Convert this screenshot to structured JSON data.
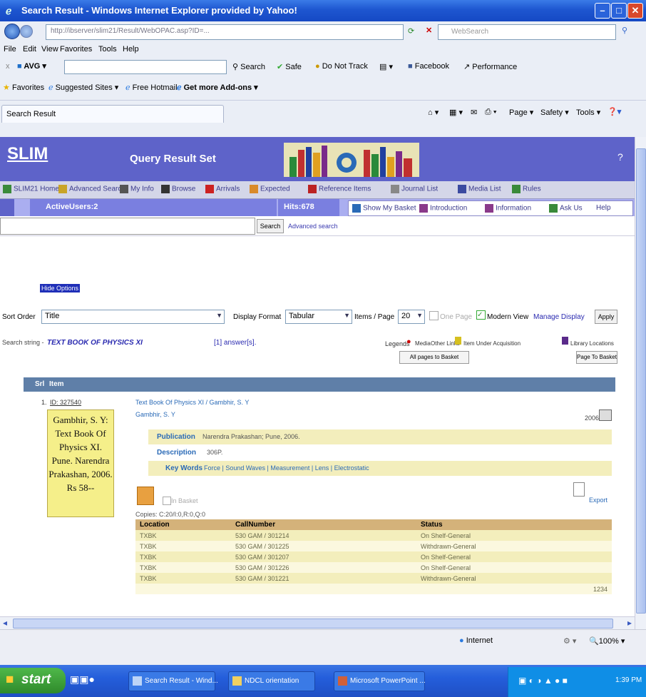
{
  "window": {
    "title": "Search Result - Windows Internet Explorer provided by Yahoo!"
  },
  "browser": {
    "address_url": "http://ibserver/slim21/Result/WebOPAC.asp?ID=...",
    "search_placeholder": "WebSearch",
    "menu": [
      "File",
      "Edit",
      "View",
      "Favorites",
      "Tools",
      "Help"
    ],
    "avg_label": "AVG",
    "toolbar": {
      "search": "Search",
      "safe": "Safe",
      "dnt": "Do Not Track",
      "facebook": "Facebook",
      "performance": "Performance"
    },
    "favorites": {
      "label": "Favorites",
      "suggested": "Suggested Sites",
      "hotmail": "Free Hotmail",
      "addons": "Get more Add-ons"
    },
    "tab_title": "Search Result",
    "command_bar": {
      "page": "Page",
      "safety": "Safety",
      "tools": "Tools"
    }
  },
  "slim": {
    "logo": "SLIM",
    "heading": "Query Result Set",
    "menu": [
      "SLIM21 Home",
      "Advanced Search",
      "My Info",
      "Browse",
      "Arrivals",
      "Expected",
      "Reference Items",
      "Journal List",
      "Media List",
      "Rules"
    ],
    "active_users": "ActiveUsers:2",
    "hits": "Hits:678",
    "links": [
      "Show My Basket",
      "Introduction",
      "Information",
      "Ask Us",
      "Help"
    ],
    "search_button": "Search",
    "advanced_search": "Advanced search",
    "hide_options": "Hide Options",
    "sort_label": "Sort Order",
    "sort_value": "Title",
    "display_format_label": "Display Format",
    "display_format_value": "Tabular",
    "items_per_page_label": "Items / Page",
    "items_per_page_value": "20",
    "one_page": "One Page",
    "modern_view": "Modern View",
    "manage_display": "Manage Display",
    "apply": "Apply",
    "search_string_label": "Search string -",
    "search_string": "TEXT BOOK OF PHYSICS XI",
    "answers": "[1] answer[s].",
    "legends": "Legends",
    "legend_media": "Media",
    "legend_other": "Other Links",
    "legend_acq": "Item Under Acquisition",
    "legend_loc": "Library Locations",
    "all_pages_basket": "All pages to Basket",
    "page_to_basket": "Page To Basket",
    "col_srl": "Srl",
    "col_item": "Item",
    "record": {
      "num": "1.",
      "id": "ID: 327540",
      "title": "Text Book Of Physics XI / Gambhir, S. Y",
      "author": "Gambhir, S. Y",
      "year": "2006",
      "card": "Gambhir, S. Y: Text Book Of Physics XI. Pune. Narendra Prakashan, 2006. Rs 58--",
      "publication_label": "Publication",
      "publication": "Narendra Prakashan; Pune, 2006.",
      "description_label": "Description",
      "description": "306P.",
      "keywords_label": "Key Words",
      "keywords": "Force | Sound Waves | Measurement | Lens | Electrostatic",
      "in_basket": "In Basket",
      "export": "Export",
      "copies": "Copies: C:20/I:0,R:0,Q:0"
    },
    "copies_table": {
      "headers": [
        "Location",
        "CallNumber",
        "Status"
      ],
      "rows": [
        [
          "TXBK",
          "530 GAM / 301214",
          "On Shelf-General"
        ],
        [
          "TXBK",
          "530 GAM / 301225",
          "Withdrawn-General"
        ],
        [
          "TXBK",
          "530 GAM / 301207",
          "On Shelf-General"
        ],
        [
          "TXBK",
          "530 GAM / 301226",
          "On Shelf-General"
        ],
        [
          "TXBK",
          "530 GAM / 301221",
          "Withdrawn-General"
        ]
      ],
      "footer_code": "1234"
    }
  },
  "statusbar": {
    "zone": "Internet",
    "zoom": "100%"
  },
  "taskbar": {
    "start": "start",
    "tasks": [
      "Search Result - Wind...",
      "NDCL orientation",
      "Microsoft PowerPoint ..."
    ],
    "clock": "1:39 PM"
  },
  "colors": {
    "accent": "#5e63c9",
    "menu_bg": "#d4d6e8",
    "table_head": "#5f7fa8",
    "copies_head": "#d4b27a",
    "copies_row": "#f3eebc"
  }
}
